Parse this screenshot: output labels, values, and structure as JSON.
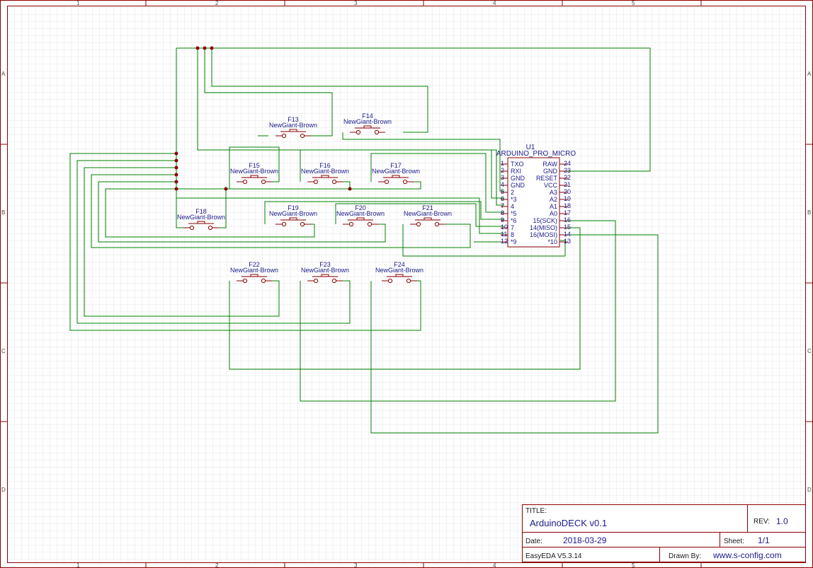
{
  "colors": {
    "wire": "#008000",
    "component": "#8b0000",
    "text": "#1a1a8c",
    "border": "#8b0000",
    "grid": "#e8e8e8"
  },
  "rulers": {
    "columns": [
      "1",
      "2",
      "3",
      "4",
      "5"
    ],
    "rows": [
      "A",
      "B",
      "C",
      "D"
    ]
  },
  "mcu": {
    "ref": "U1",
    "name": "ARDUINO_PRO_MICRO",
    "left_pins": [
      {
        "num": "1",
        "label": "TXO"
      },
      {
        "num": "2",
        "label": "RXI"
      },
      {
        "num": "3",
        "label": "GND"
      },
      {
        "num": "4",
        "label": "GND"
      },
      {
        "num": "5",
        "label": "2"
      },
      {
        "num": "6",
        "label": "*3"
      },
      {
        "num": "7",
        "label": "4"
      },
      {
        "num": "8",
        "label": "*5"
      },
      {
        "num": "9",
        "label": "*6"
      },
      {
        "num": "10",
        "label": "7"
      },
      {
        "num": "11",
        "label": "8"
      },
      {
        "num": "12",
        "label": "*9"
      }
    ],
    "right_pins": [
      {
        "num": "24",
        "label": "RAW"
      },
      {
        "num": "23",
        "label": "GND"
      },
      {
        "num": "22",
        "label": "RESET"
      },
      {
        "num": "21",
        "label": "VCC"
      },
      {
        "num": "20",
        "label": "A3"
      },
      {
        "num": "19",
        "label": "A2"
      },
      {
        "num": "18",
        "label": "A1"
      },
      {
        "num": "17",
        "label": "A0"
      },
      {
        "num": "16",
        "label": "15(SCK)"
      },
      {
        "num": "15",
        "label": "14(MISO)"
      },
      {
        "num": "14",
        "label": "16(MOSI)"
      },
      {
        "num": "13",
        "label": "*10"
      }
    ]
  },
  "switches": [
    {
      "ref": "F13",
      "value": "NewGiant-Brown"
    },
    {
      "ref": "F14",
      "value": "NewGiant-Brown"
    },
    {
      "ref": "F15",
      "value": "NewGiant-Brown"
    },
    {
      "ref": "F16",
      "value": "NewGiant-Brown"
    },
    {
      "ref": "F17",
      "value": "NewGiant-Brown"
    },
    {
      "ref": "F18",
      "value": "NewGiant-Brown"
    },
    {
      "ref": "F19",
      "value": "NewGiant-Brown"
    },
    {
      "ref": "F20",
      "value": "NewGiant-Brown"
    },
    {
      "ref": "F21",
      "value": "NewGiant-Brown"
    },
    {
      "ref": "F22",
      "value": "NewGiant-Brown"
    },
    {
      "ref": "F23",
      "value": "NewGiant-Brown"
    },
    {
      "ref": "F24",
      "value": "NewGiant-Brown"
    }
  ],
  "title_block": {
    "title_label": "TITLE:",
    "title": "ArduinoDECK v0.1",
    "rev_label": "REV:",
    "rev": "1.0",
    "date_label": "Date:",
    "date": "2018-03-29",
    "sheet_label": "Sheet:",
    "sheet": "1/1",
    "software": "EasyEDA V5.3.14",
    "drawn_label": "Drawn By:",
    "drawn_by": "www.s-config.com"
  }
}
